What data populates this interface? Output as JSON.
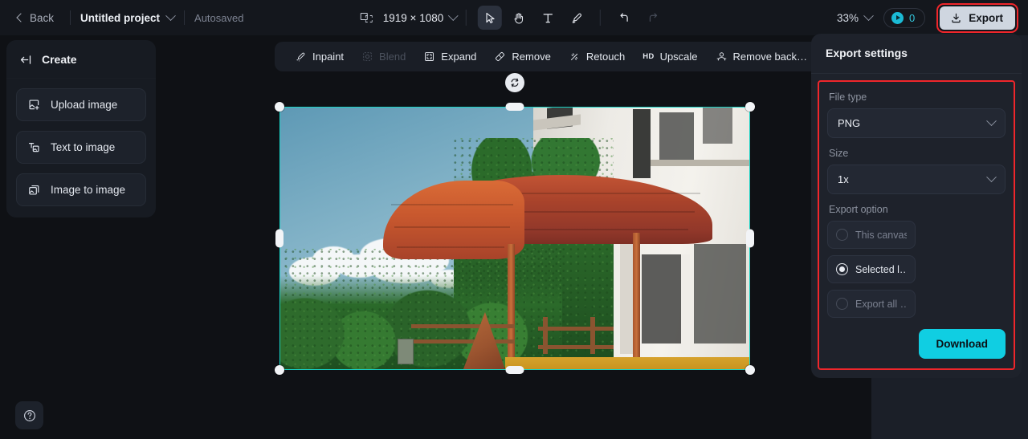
{
  "topbar": {
    "back_label": "Back",
    "project_name": "Untitled project",
    "autosaved_label": "Autosaved",
    "canvas_dimensions": "1919 × 1080",
    "zoom_level": "33%",
    "credits_count": "0",
    "export_label": "Export",
    "tools": [
      {
        "name": "select-tool",
        "glyph": "cursor",
        "active": true
      },
      {
        "name": "hand-tool",
        "glyph": "hand",
        "active": false
      },
      {
        "name": "text-tool",
        "glyph": "text",
        "active": false
      },
      {
        "name": "brush-tool",
        "glyph": "brush",
        "active": false
      },
      {
        "name": "undo-tool",
        "glyph": "undo",
        "active": false
      },
      {
        "name": "redo-tool",
        "glyph": "redo",
        "active": false
      }
    ]
  },
  "sidebar": {
    "title": "Create",
    "items": [
      {
        "label": "Upload image",
        "icon": "upload-image-icon"
      },
      {
        "label": "Text to image",
        "icon": "text-to-image-icon"
      },
      {
        "label": "Image to image",
        "icon": "image-to-image-icon"
      }
    ],
    "help_icon": "help-icon"
  },
  "edit_toolbar": {
    "items": [
      {
        "label": "Inpaint",
        "icon": "inpaint-icon",
        "disabled": false
      },
      {
        "label": "Blend",
        "icon": "blend-icon",
        "disabled": true
      },
      {
        "label": "Expand",
        "icon": "expand-icon",
        "disabled": false
      },
      {
        "label": "Remove",
        "icon": "remove-icon",
        "disabled": false
      },
      {
        "label": "Retouch",
        "icon": "retouch-icon",
        "disabled": false
      },
      {
        "label": "Upscale",
        "icon": "hd-icon",
        "badge": "HD",
        "disabled": false
      },
      {
        "label": "Remove back…",
        "icon": "remove-background-icon",
        "disabled": false
      }
    ]
  },
  "canvas": {
    "rotate_icon": "rotate-icon",
    "selection_color": "#19D3C5",
    "image_description": "Modern white building with terracotta curved awning, trees and blue sky"
  },
  "export_panel": {
    "title": "Export settings",
    "file_type_label": "File type",
    "file_type_value": "PNG",
    "size_label": "Size",
    "size_value": "1x",
    "export_option_label": "Export option",
    "options": [
      {
        "label": "This canvas",
        "selected": false,
        "dim": true
      },
      {
        "label": "Selected l…",
        "selected": true,
        "dim": false
      },
      {
        "label": "Export all …",
        "selected": false,
        "dim": true
      }
    ],
    "download_label": "Download",
    "highlight_color": "#F0262B",
    "download_color": "#10CEE2"
  }
}
